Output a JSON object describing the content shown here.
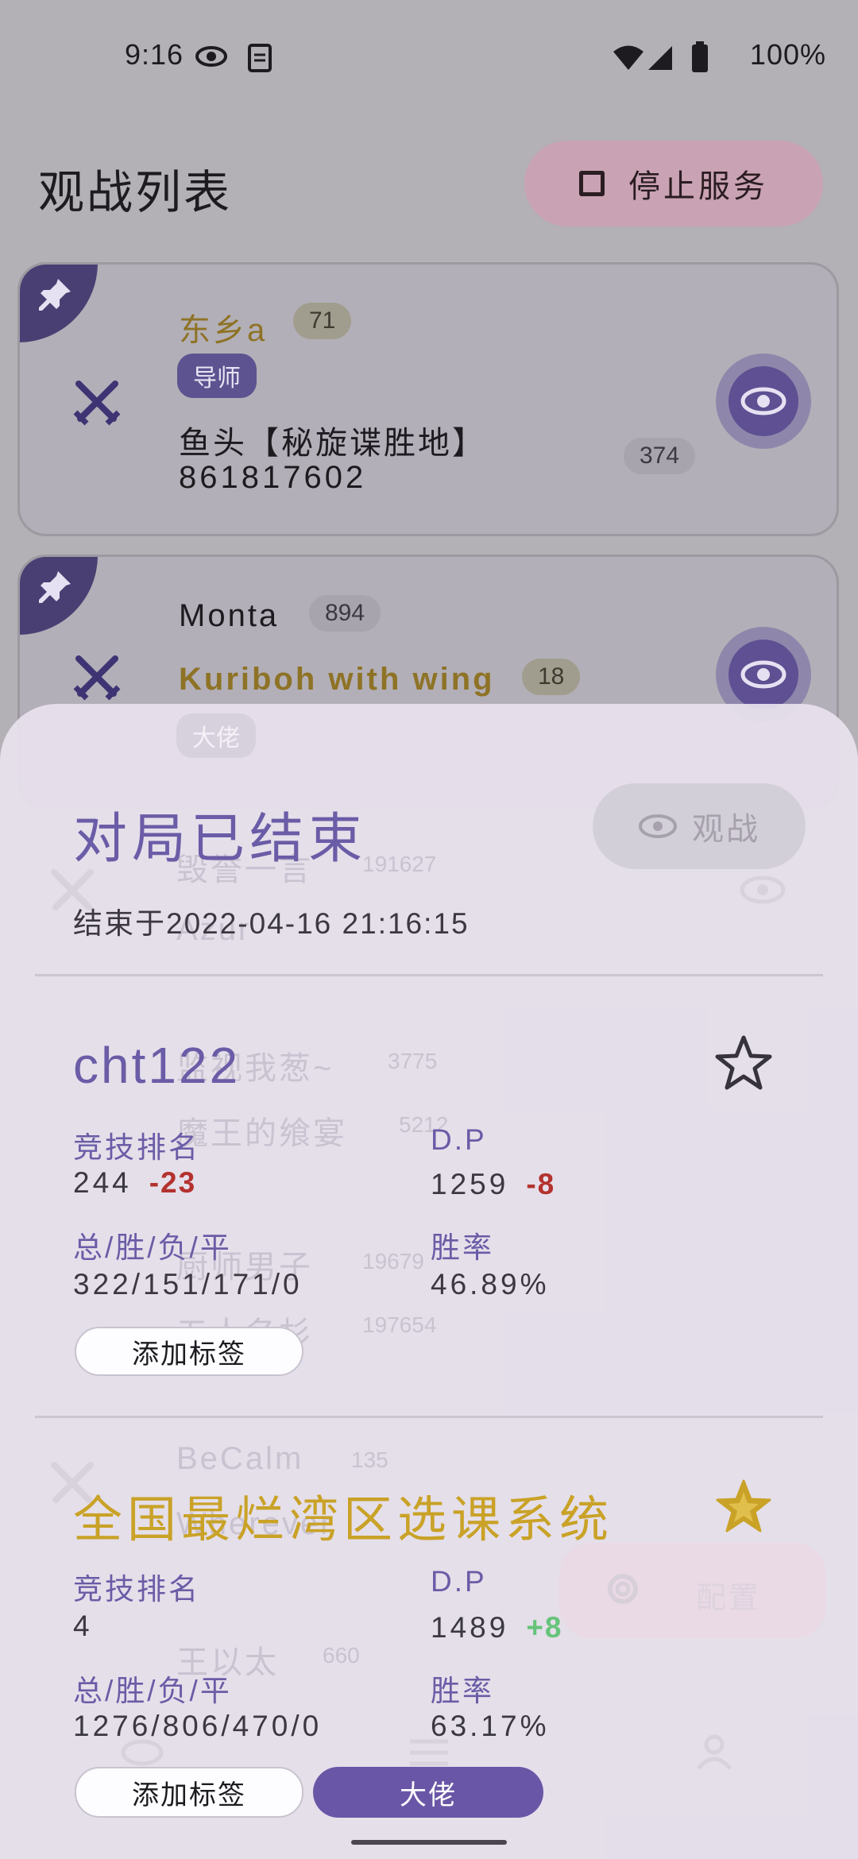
{
  "status_bar": {
    "time": "9:16",
    "battery": "100%"
  },
  "page": {
    "title": "观战列表",
    "stop_button": "停止服务"
  },
  "cards": [
    {
      "player1": "东乡a",
      "player1_rank": "71",
      "player1_tag": "导师",
      "player2": "鱼头【秘旋谍胜地】",
      "player2_id": "861817602",
      "player2_rank": "374"
    },
    {
      "player1": "Monta",
      "player1_rank": "894",
      "player2": "Kuriboh with wing",
      "player2_rank": "18",
      "player2_tag": "大佬"
    }
  ],
  "background_ghost": {
    "rows": [
      {
        "name": "毁誉一言",
        "rank": "191627"
      },
      {
        "name": "Azur",
        "rank": ""
      },
      {
        "name": "监视我葱~",
        "rank": "3775"
      },
      {
        "name": "魔王的飨宴",
        "rank": "5212"
      },
      {
        "name": "厨师男子",
        "rank": "19679"
      },
      {
        "name": "五人名杉",
        "rank": "197654"
      },
      {
        "name": "BeCalm",
        "rank": "135"
      },
      {
        "name": "Wherever",
        "rank": ""
      },
      {
        "name": "王以太",
        "rank": "660"
      }
    ],
    "config_button": "配置"
  },
  "sheet": {
    "title": "对局已结束",
    "ended_at": "结束于2022-04-16 21:16:15",
    "watch_button": "观战",
    "players": [
      {
        "name": "cht122",
        "rank_label": "竞技排名",
        "rank": "244",
        "rank_change": "-23",
        "dp_label": "D.P",
        "dp": "1259",
        "dp_change": "-8",
        "record_label": "总/胜/负/平",
        "record": "322/151/171/0",
        "winrate_label": "胜率",
        "winrate": "46.89%",
        "add_tag": "添加标签",
        "favorited": false
      },
      {
        "name": "全国最烂湾区选课系统",
        "rank_label": "竞技排名",
        "rank": "4",
        "dp_label": "D.P",
        "dp": "1489",
        "dp_change": "+8",
        "record_label": "总/胜/负/平",
        "record": "1276/806/470/0",
        "winrate_label": "胜率",
        "winrate": "63.17%",
        "add_tag": "添加标签",
        "tag": "大佬",
        "favorited": true
      }
    ]
  },
  "icons": [
    "visibility-icon",
    "note-icon",
    "wifi-icon",
    "signal-icon",
    "battery-icon",
    "stop-icon",
    "pin-icon",
    "swords-icon",
    "eye-icon",
    "star-outline-icon",
    "star-filled-icon",
    "settings-icon",
    "list-icon",
    "person-icon"
  ],
  "colors": {
    "accent": "#6a56a6",
    "gold": "#c9a227",
    "negative": "#b3322e",
    "positive": "#66c47a"
  }
}
